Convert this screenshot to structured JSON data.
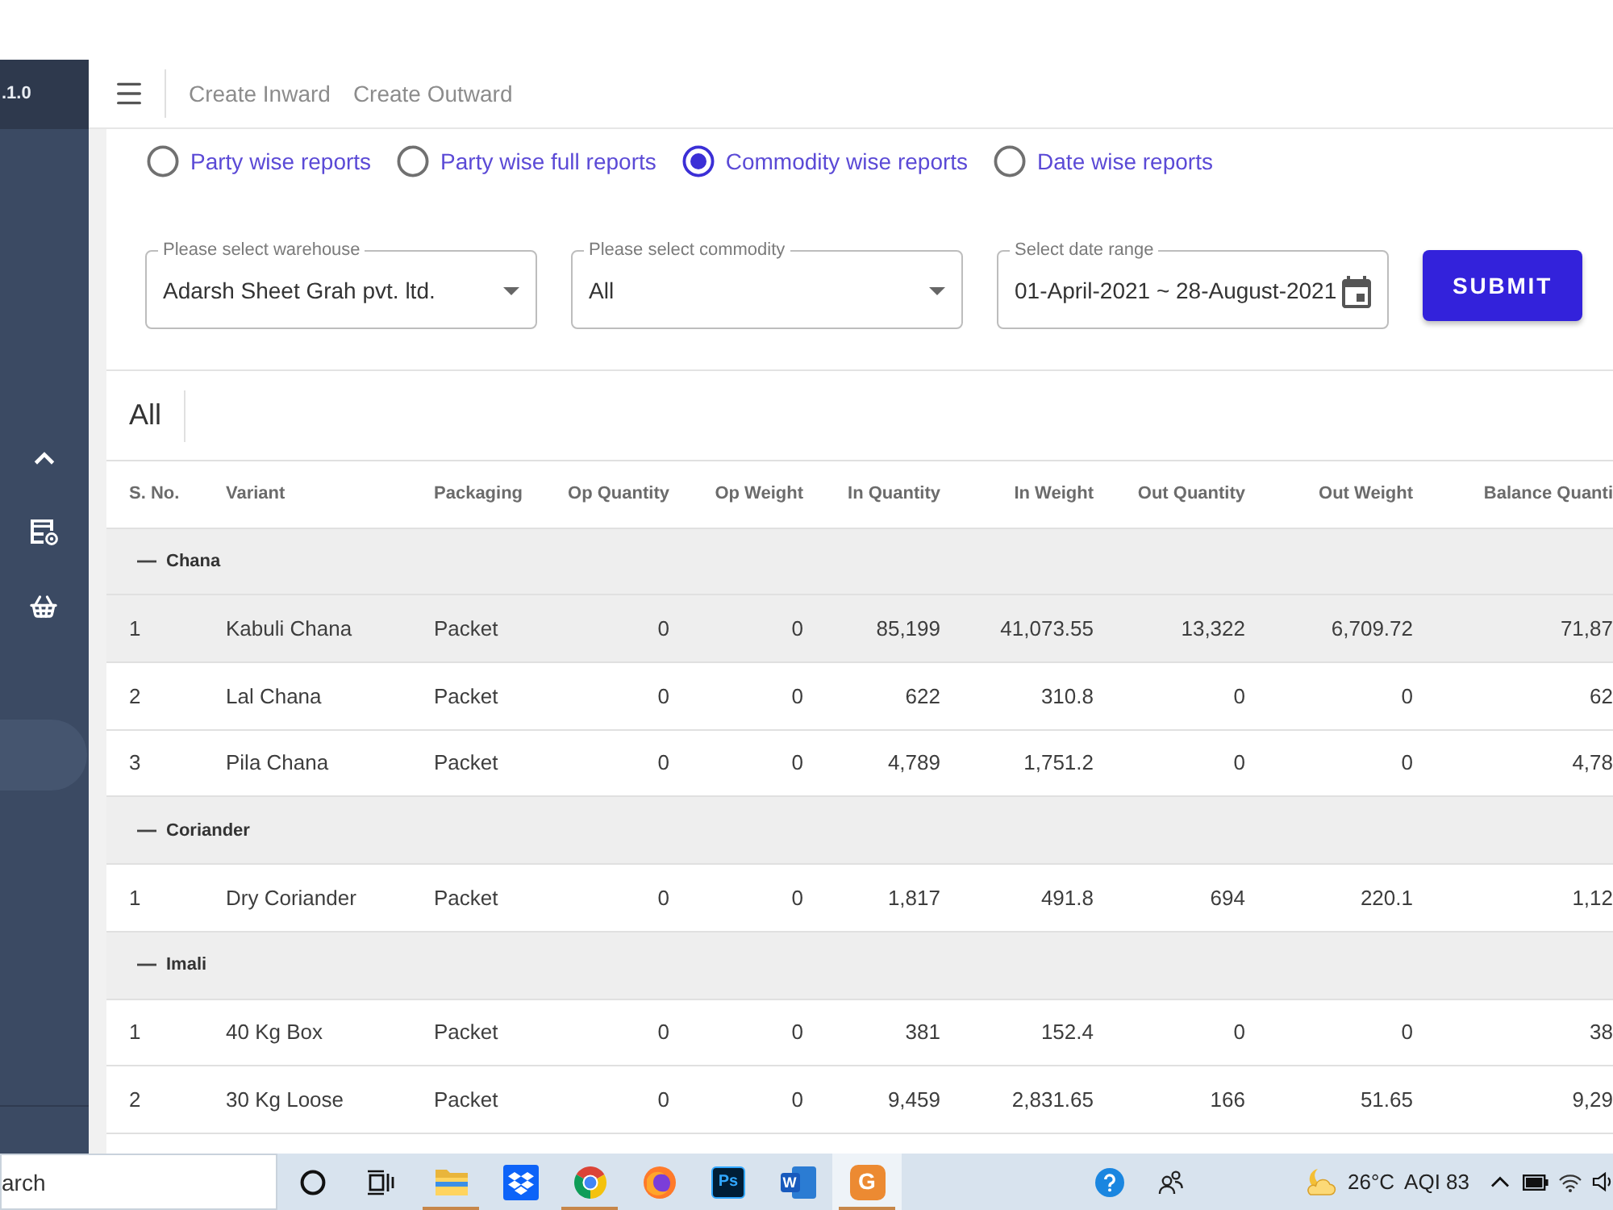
{
  "sidebar": {
    "version": ".1.0",
    "items": [
      {
        "kind": "toggle",
        "selected": false
      },
      {
        "kind": "report",
        "selected": false
      },
      {
        "kind": "basket",
        "selected": false
      },
      {
        "kind": "blank",
        "selected": true
      }
    ]
  },
  "header": {
    "links": [
      "Create Inward",
      "Create Outward"
    ]
  },
  "report_types": [
    {
      "label": "Party wise reports",
      "selected": false
    },
    {
      "label": "Party wise full reports",
      "selected": false
    },
    {
      "label": "Commodity wise reports",
      "selected": true
    },
    {
      "label": "Date wise reports",
      "selected": false
    }
  ],
  "filters": [
    {
      "kind": "select",
      "label": "Please select warehouse",
      "value": "Adarsh Sheet Grah pvt. ltd."
    },
    {
      "kind": "select",
      "label": "Please select commodity",
      "value": "All"
    },
    {
      "kind": "date",
      "label": "Select date range",
      "value": "01-April-2021 ~ 28-August-2021"
    }
  ],
  "submit_button": "SUBMIT",
  "table": {
    "title": "All",
    "columns": [
      {
        "label": "S. No.",
        "kind": "text"
      },
      {
        "label": "Variant",
        "kind": "text"
      },
      {
        "label": "Packaging",
        "kind": "text"
      },
      {
        "label": "Op Quantity",
        "kind": "number"
      },
      {
        "label": "Op Weight",
        "kind": "number"
      },
      {
        "label": "In Quantity",
        "kind": "number"
      },
      {
        "label": "In Weight",
        "kind": "number"
      },
      {
        "label": "Out Quantity",
        "kind": "number"
      },
      {
        "label": "Out Weight",
        "kind": "number"
      },
      {
        "label": "Balance Quanti",
        "kind": "number"
      }
    ],
    "groups": [
      {
        "name": "Chana",
        "expanded": true,
        "rows": [
          {
            "highlighted": true,
            "cells": [
              "1",
              "Kabuli Chana",
              "Packet",
              "0",
              "0",
              "85,199",
              "41,073.55",
              "13,322",
              "6,709.72",
              "71,87"
            ]
          },
          {
            "highlighted": false,
            "cells": [
              "2",
              "Lal Chana",
              "Packet",
              "0",
              "0",
              "622",
              "310.8",
              "0",
              "0",
              "62"
            ]
          },
          {
            "highlighted": false,
            "cells": [
              "3",
              "Pila Chana",
              "Packet",
              "0",
              "0",
              "4,789",
              "1,751.2",
              "0",
              "0",
              "4,78"
            ]
          }
        ]
      },
      {
        "name": "Coriander",
        "expanded": true,
        "rows": [
          {
            "highlighted": false,
            "cells": [
              "1",
              "Dry Coriander",
              "Packet",
              "0",
              "0",
              "1,817",
              "491.8",
              "694",
              "220.1",
              "1,12"
            ]
          }
        ]
      },
      {
        "name": "Imali",
        "expanded": true,
        "rows": [
          {
            "highlighted": false,
            "cells": [
              "1",
              "40 Kg Box",
              "Packet",
              "0",
              "0",
              "381",
              "152.4",
              "0",
              "0",
              "38"
            ]
          },
          {
            "highlighted": false,
            "cells": [
              "2",
              "30 Kg Loose",
              "Packet",
              "0",
              "0",
              "9,459",
              "2,831.65",
              "166",
              "51.65",
              "9,29"
            ]
          }
        ]
      }
    ]
  },
  "taskbar": {
    "search": {
      "placeholder": "arch"
    },
    "apps": [
      {
        "kind": "cortana",
        "running": false,
        "active": false
      },
      {
        "kind": "taskview",
        "running": false,
        "active": false
      },
      {
        "kind": "explorer",
        "running": true,
        "active": false
      },
      {
        "kind": "dropbox",
        "running": false,
        "active": false
      },
      {
        "kind": "chrome",
        "running": true,
        "active": false
      },
      {
        "kind": "firefox",
        "running": false,
        "active": false
      },
      {
        "kind": "photoshop",
        "glyph": "Ps",
        "running": false,
        "active": false
      },
      {
        "kind": "word",
        "glyph": "W",
        "running": false,
        "active": false
      },
      {
        "kind": "tile",
        "glyph": "G",
        "running": true,
        "active": true
      }
    ],
    "weather": {
      "temperature": "26°C",
      "air_quality": "AQI 83"
    }
  }
}
